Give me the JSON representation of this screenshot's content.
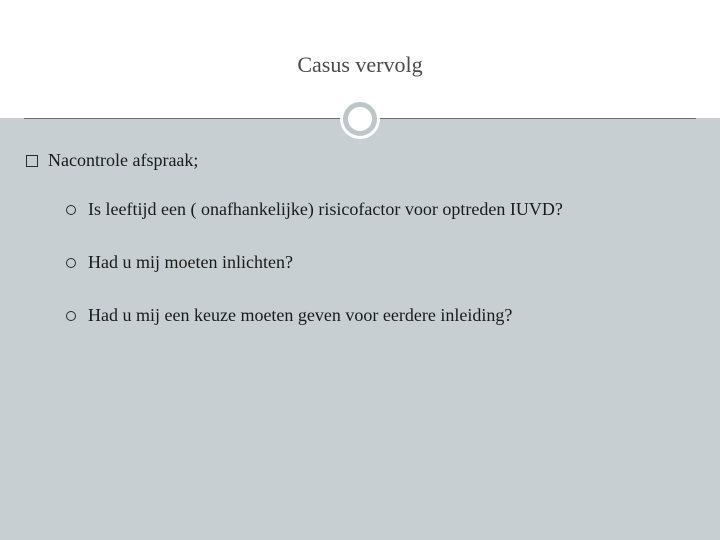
{
  "slide": {
    "title": "Casus vervolg",
    "main_item": "Nacontrole afspraak;",
    "sub_items": [
      "Is leeftijd een ( onafhankelijke) risicofactor voor optreden IUVD?",
      "Had u mij moeten inlichten?",
      "Had u mij een keuze moeten geven voor eerdere inleiding?"
    ]
  }
}
